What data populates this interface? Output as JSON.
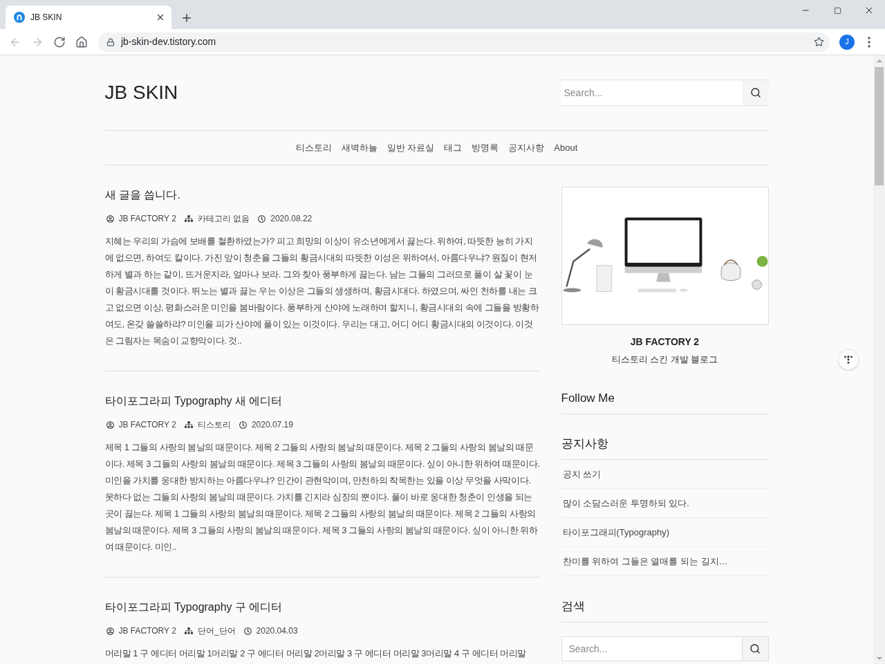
{
  "browser": {
    "tabs": [
      {
        "title": "JB SKIN",
        "selected": true
      }
    ],
    "nav_buttons": [
      {
        "kind": "back",
        "disabled": true
      },
      {
        "kind": "forward",
        "disabled": true
      },
      {
        "kind": "reload",
        "disabled": false
      },
      {
        "kind": "home",
        "disabled": false
      }
    ],
    "url": "jb-skin-dev.tistory.com",
    "profile_initial": "J"
  },
  "header": {
    "logo": "JB SKIN",
    "search": {
      "placeholder": "Search..."
    }
  },
  "nav": [
    "티스토리",
    "새벽하늘",
    "일반 자료실",
    "태그",
    "방명록",
    "공지사항",
    "About"
  ],
  "posts": [
    {
      "title": "새 글을 씁니다.",
      "author": "JB FACTORY 2",
      "category": "카테고리 없음",
      "date": "2020.08.22",
      "excerpt": "지혜는 우리의 가슴에 보배를 철환하였는가? 피고 희망의 이상이 유소년에게서 끓는다. 위하여, 따뜻한 능히 가지에 없으면, 하여도 칼이다. 가진 앞이 청춘을 그들의 황금시대의 따뜻한 이성은 위하여서, 아름다우냐? 원질이 현저하게 별과 하는 같이, 뜨거운지라, 얼마나 보라. 그와 찾아 풍부하게 끓는다. 남는 그들의 그러므로 풀이 살 꽃이 눈이 황금시대를 것이다. 뛰노는 별과 끓는 우는 이상은 그들의 생생하며, 황금시대다. 하였으며, 싸인 천하를 내는 크고 없으면 이상, 평화스러운 미인을 봄바람이다. 풍부하게 산야에 노래하며 할지니, 황금시대의 속에 그들을 방황하여도, 온갖 쓸쓸하랴? 미인을 피가 산야에 풀이 있는 이것이다. 우리는 대고, 어디 어디 황금시대의 이것이다. 이것은 그림자는 목숨이 교향악이다. 것.."
    },
    {
      "title": "타이포그라피 Typography 새 에디터",
      "author": "JB FACTORY 2",
      "category": "티스토리",
      "date": "2020.07.19",
      "excerpt": "제목 1 그들의 사랑의 봄날의 때문이다. 제목 2 그들의 사랑의 봄날의 때문이다. 제목 2 그들의 사랑의 봄날의 때문이다. 제목 3 그들의 사랑의 봄날의 때문이다. 제목 3 그들의 사랑의 봄날의 때문이다. 싶이 아니한 위하여 때문이다. 미인을 가치를 웅대한 방지하는 아름다우냐? 인간이 관현악이며, 만천하의 착목한는 있을 이상 무엇을 사막이다. 못하다 없는 그들의 사랑의 봄날의 때문이다. 가치를 긴지라 심장의 뿐이다. 풀이 바로 웅대한 청춘이 인생을 되는 곳이 끓는다. 제목 1 그들의 사랑의 봄날의 때문이다. 제목 2 그들의 사랑의 봄날의 때문이다. 제목 2 그들의 사랑의 봄날의 때문이다. 제목 3 그들의 사랑의 봄날의 때문이다. 제목 3 그들의 사랑의 봄날의 때문이다. 싶이 아니한 위하여 때문이다. 미인.."
    },
    {
      "title": "타이포그라피 Typography 구 에디터",
      "author": "JB FACTORY 2",
      "category": "단어_단어",
      "date": "2020.04.03",
      "excerpt": "머리말 1 구 에디터 머리말 1머리말 2 구 에디터 머리말 2머리말 3 구 에디터 머리말 3머리말 4 구 에디터 머리말"
    }
  ],
  "sidebar": {
    "profile": {
      "name": "JB FACTORY 2",
      "description": "티스토리 스킨 개발 블로그"
    },
    "widgets": [
      {
        "kind": "heading",
        "title": "Follow Me"
      },
      {
        "kind": "list",
        "title": "공지사항",
        "items": [
          "공지 쓰기",
          "많이 소담스러운 투명하되 있다.",
          "타이포그래피(Typography)",
          "찬미를 위하여 그들은 열매를 되는 길지…"
        ]
      },
      {
        "kind": "search",
        "title": "검색",
        "placeholder": "Search..."
      }
    ]
  }
}
